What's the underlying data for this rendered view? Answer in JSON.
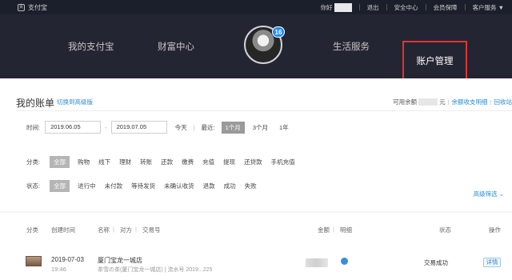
{
  "topbar": {
    "logo": "支付宝",
    "greeting": "你好",
    "links": [
      "退出",
      "安全中心",
      "会员保障",
      "客户服务"
    ]
  },
  "nav": {
    "items": [
      "我的支付宝",
      "财富中心",
      "生活服务",
      "账户管理"
    ],
    "badge": "16"
  },
  "bill": {
    "title": "我的账单",
    "switch_label": "切换到高级版",
    "balance_label": "可用余额",
    "balance_unit": "元",
    "balance_link": "余额收支明细",
    "recycle_link": "回收站"
  },
  "time_filter": {
    "label": "时间:",
    "start": "2019.06.05",
    "sep": "-",
    "end": "2019.07.05",
    "today": "今天",
    "recent_label": "最近:",
    "one_month": "1个月",
    "three_months": "3个月",
    "one_year": "1年"
  },
  "category": {
    "label": "分类:",
    "items": [
      "全部",
      "购物",
      "线下",
      "理财",
      "转账",
      "还款",
      "缴费",
      "充值",
      "提现",
      "还贷款",
      "手机充值"
    ]
  },
  "status": {
    "label": "状态:",
    "items": [
      "全部",
      "进行中",
      "未付款",
      "等待发货",
      "未确认收货",
      "退款",
      "成功",
      "失败"
    ]
  },
  "advanced_filter": "高级筛选",
  "table": {
    "headers": {
      "category": "分类",
      "created": "创建时间",
      "name": "名称",
      "counterparty": "对方",
      "tx_no": "交易号",
      "amount": "金额",
      "detail": "明细",
      "state": "状态",
      "action": "操作"
    },
    "rows": [
      {
        "date": "2019-07-03",
        "time": "19:46",
        "name": "厦门宝龙一城店",
        "sub": "茶雪の茶(厦门宝龙一城店) | 流水号 2019...225",
        "status": "交易成功",
        "action": "详情"
      }
    ]
  },
  "colors": {
    "nav_bg": "#242533",
    "accent": "#2b8ccf",
    "highlight_border": "#e3342f"
  }
}
